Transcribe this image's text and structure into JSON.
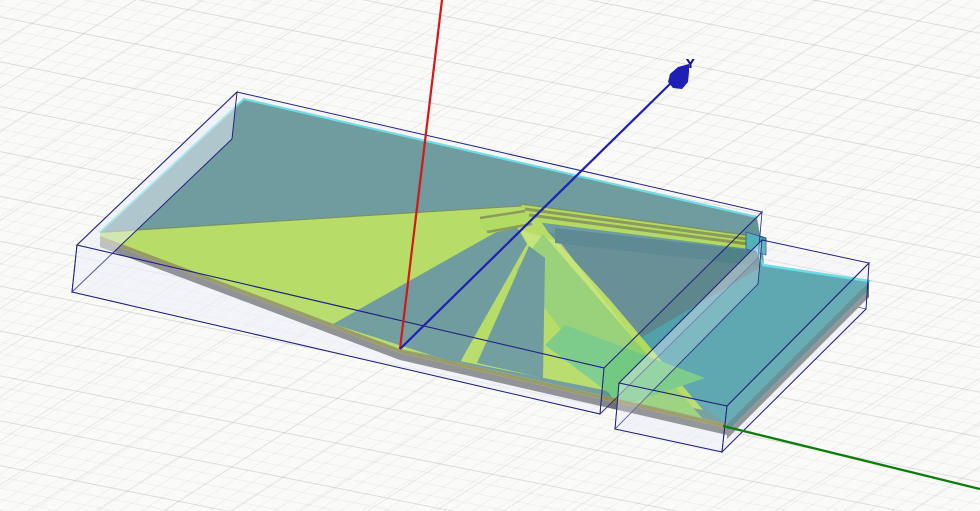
{
  "viewport": {
    "type": "3d-modeler-viewport",
    "background": "isometric-grid",
    "grid_minor_color": "#e6e6e8",
    "grid_major_color": "#d9d9dc"
  },
  "axes": {
    "x": {
      "label": "",
      "color": "#0a7c0a"
    },
    "y": {
      "label": "Y",
      "color": "#1f1fb5",
      "label_color": "#15158f"
    },
    "z": {
      "label": "",
      "color": "#d81616"
    }
  },
  "colors": {
    "substrate_teal": "#44807f",
    "teal_dark_wing": "#3d7076",
    "teal_bright": "#2f9199",
    "teal_cap": "#2fa7ad",
    "metal_lime": "#a5d737",
    "metal_lime_bright": "#9dd52f",
    "metal_lime_streak": "#bfe35a",
    "metal_medium_green": "#7cc84f",
    "metal_sea_green": "#57c167",
    "gap_olive": "#6b7e27",
    "ridge_face_teal": "#2e6a70",
    "edge_cyan": "#3fd9de",
    "edge_navy": "#23237c",
    "side_olive": "#7b7d2e",
    "side_gray": "#6f7071",
    "airbox_fill": "#eef0fa"
  }
}
